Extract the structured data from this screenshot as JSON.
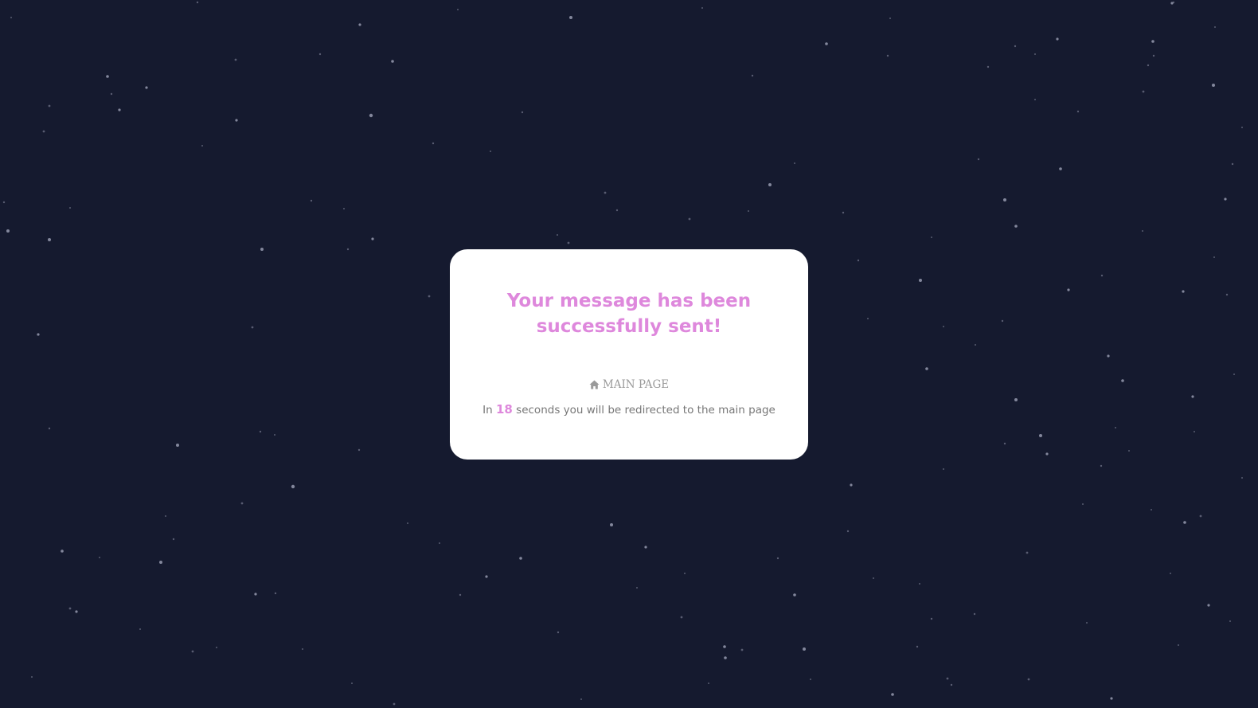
{
  "page": {
    "background_color": "#151a2f",
    "star_color": "#8f93a8"
  },
  "card": {
    "title": "Your message has been successfully sent!",
    "title_color": "#de88dc",
    "home_link": {
      "icon": "home-icon",
      "label": "MAIN PAGE"
    },
    "redirect": {
      "prefix": "In",
      "seconds": "18",
      "suffix": "seconds you will be redirected to the main page"
    }
  }
}
